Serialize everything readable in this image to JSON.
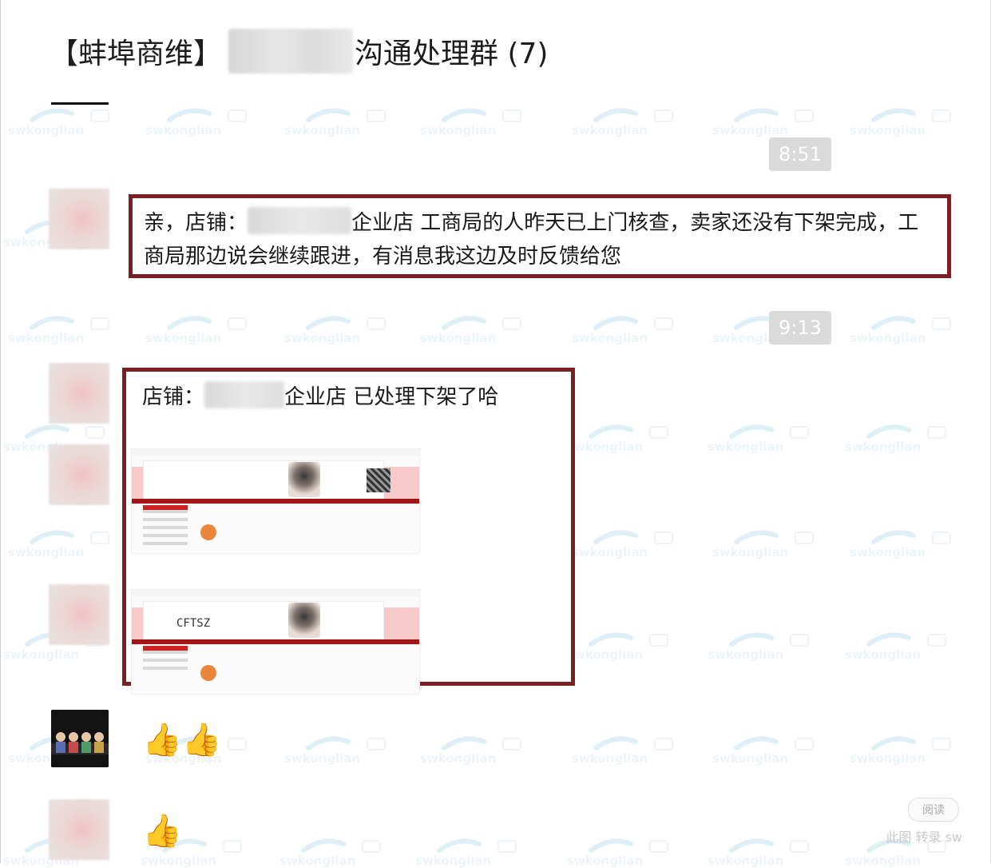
{
  "chat": {
    "title_prefix": "【蚌埠商维】",
    "title_suffix": "沟通处理群 (7)"
  },
  "timestamps": [
    "8:51",
    "9:13"
  ],
  "messages": {
    "m1_a": "亲，店铺：",
    "m1_b": "企业店 工商局的人昨天已上门核查，卖家还没有下架完成，工商局那边说会继续跟进，有消息我这边及时反馈给您",
    "m2_a": "店铺：",
    "m2_b": "企业店  已处理下架了哈",
    "thumbs_a": "👍👍",
    "thumbs_b": "👍"
  },
  "watermark": {
    "text": "swkonglian"
  },
  "embedded": {
    "shot1_logo": "",
    "shot2_logo": "CFTSZ"
  },
  "footer": {
    "pill": "阅读",
    "faint": "此图 转录  sw"
  }
}
